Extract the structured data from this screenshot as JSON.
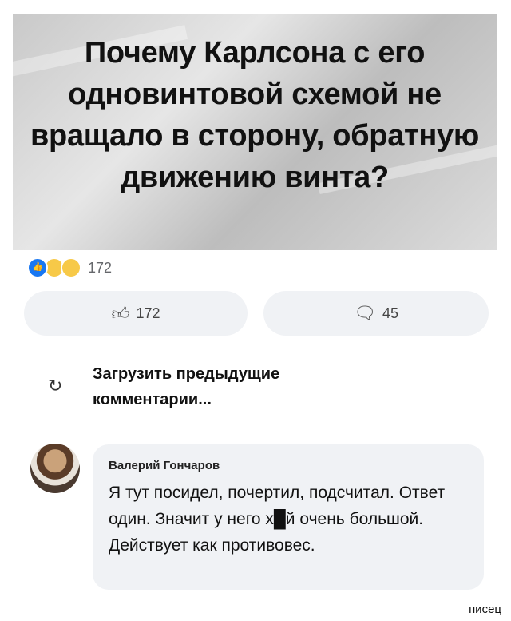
{
  "post": {
    "title": "Почему Карлсона с его одновинтовой схемой не вращало в сторону, обратную движению винта?"
  },
  "reactions": {
    "icons": [
      "like-icon",
      "haha-icon",
      "wow-icon"
    ],
    "count": "172"
  },
  "actions": {
    "like_count": "172",
    "comment_count": "45"
  },
  "load_previous": "Загрузить предыдущие комментарии...",
  "comment": {
    "author": "Валерий Гончаров",
    "text": "Я тут посидел, почертил, подсчитал. Ответ один. Значит у него х█й очень большой. Действует как противовес."
  },
  "watermark": "писец",
  "colors": {
    "like_blue": "#1877f2",
    "bubble_bg": "#f0f2f5"
  }
}
